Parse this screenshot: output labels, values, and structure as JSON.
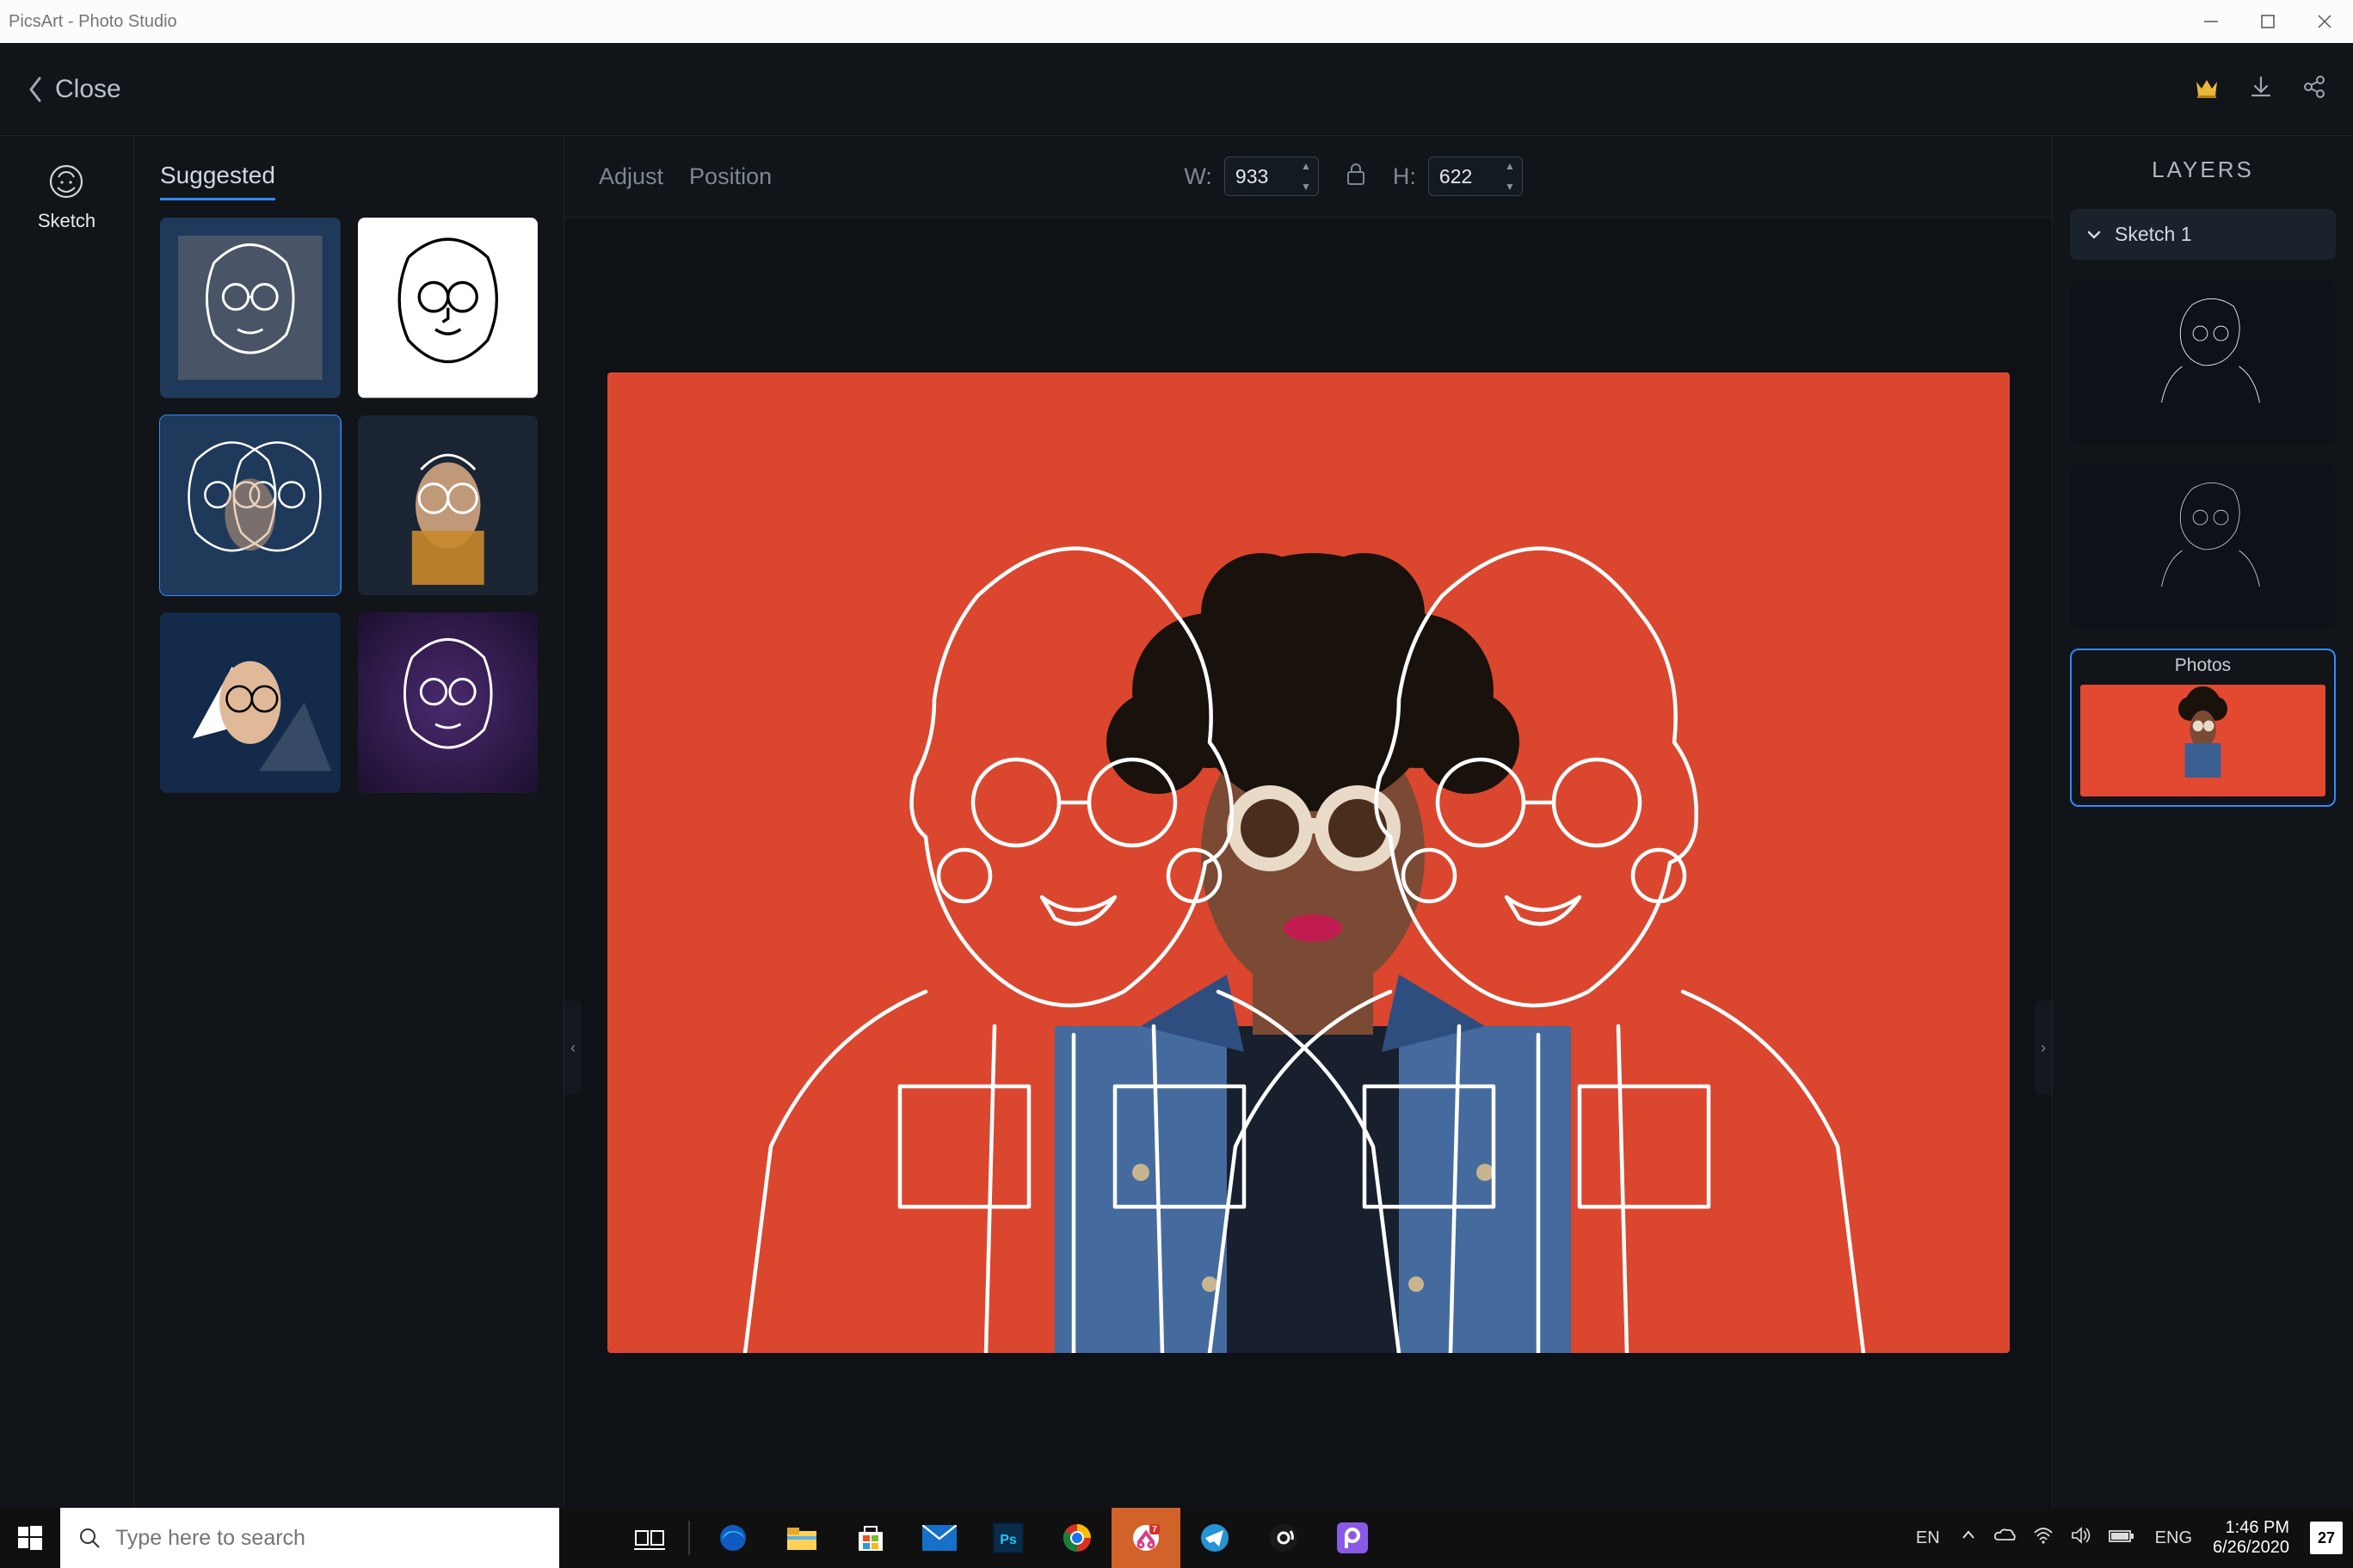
{
  "window": {
    "title": "PicsArt - Photo Studio"
  },
  "app_bar": {
    "close": "Close"
  },
  "sidebar": {
    "tool_label": "Sketch"
  },
  "suggested": {
    "tab": "Suggested"
  },
  "options": {
    "adjust": "Adjust",
    "position": "Position",
    "w_label": "W:",
    "h_label": "H:",
    "width": "933",
    "height": "622"
  },
  "layers": {
    "title": "LAYERS",
    "sketch_header": "Sketch 1",
    "photos_label": "Photos"
  },
  "taskbar": {
    "search_placeholder": "Type here to search",
    "lang_input": "EN",
    "lang_kbd": "ENG",
    "time": "1:46 PM",
    "date": "6/26/2020",
    "notif": "27"
  },
  "colors": {
    "accent": "#2f8aff",
    "canvas_bg": "#e34931"
  }
}
